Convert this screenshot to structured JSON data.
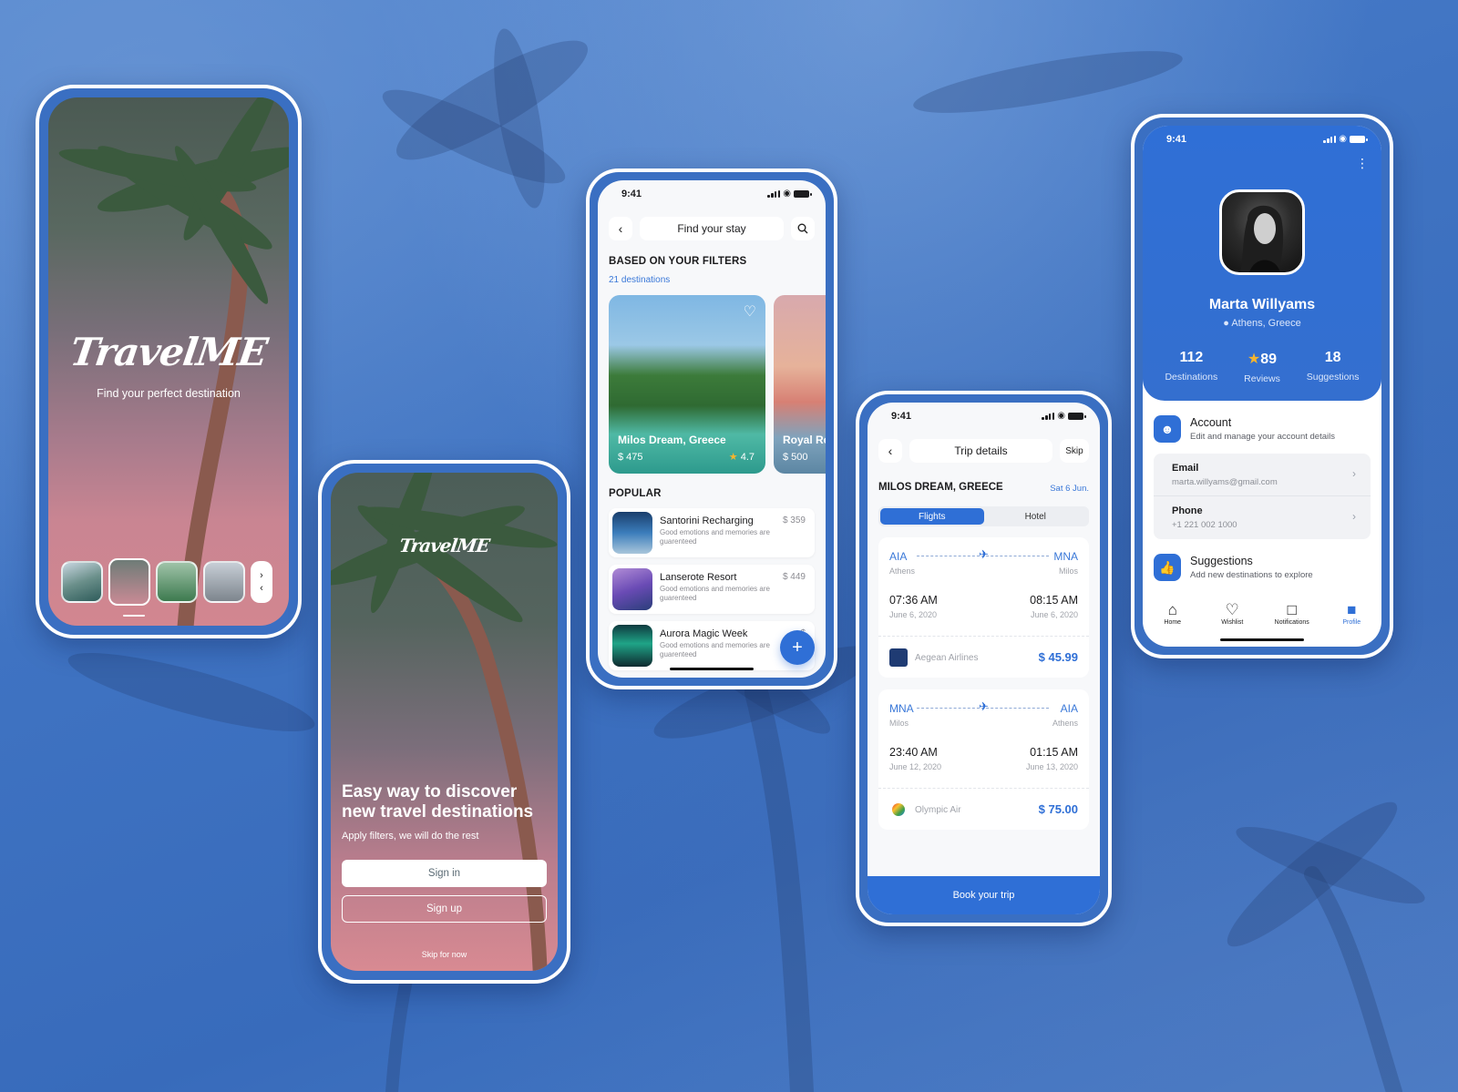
{
  "colors": {
    "accent": "#2f6fd6",
    "background": "#3f74c4",
    "star": "#f5b52e"
  },
  "splash": {
    "logo": "TravelME",
    "tagline": "Find your perfect destination",
    "thumb_next_icons": [
      "chevron-right-icon",
      "chevron-left-icon"
    ]
  },
  "onboarding": {
    "logo": "TravelME",
    "headline": "Easy way to discover new travel destinations",
    "subtitle": "Apply filters, we will do the rest",
    "sign_in": "Sign in",
    "sign_up": "Sign up",
    "skip": "Skip for now"
  },
  "stay": {
    "time": "9:41",
    "title": "Find your stay",
    "filters_heading": "BASED ON YOUR FILTERS",
    "destinations_count": "21 destinations",
    "featured": [
      {
        "name": "Milos Dream, Greece",
        "price": "$ 475",
        "rating": "4.7"
      },
      {
        "name": "Royal Res",
        "price": "$ 500"
      }
    ],
    "popular_heading": "POPULAR",
    "popular": [
      {
        "name": "Santorini Recharging",
        "desc": "Good emotions and memories are guarenteed",
        "price": "$ 359"
      },
      {
        "name": "Lanserote Resort",
        "desc": "Good emotions and memories are guarenteed",
        "price": "$ 449"
      },
      {
        "name": "Aurora Magic Week",
        "desc": "Good emotions and memories are guarenteed",
        "price": "$"
      }
    ],
    "fab": "+"
  },
  "trip": {
    "time": "9:41",
    "title": "Trip details",
    "skip": "Skip",
    "destination": "MILOS DREAM, GREECE",
    "date": "Sat 6 Jun.",
    "tabs": [
      "Flights",
      "Hotel"
    ],
    "flights": [
      {
        "from": "AIA",
        "from_city": "Athens",
        "to": "MNA",
        "to_city": "Milos",
        "depart_time": "07:36 AM",
        "depart_date": "June 6, 2020",
        "arrive_time": "08:15 AM",
        "arrive_date": "June 6, 2020",
        "airline": "Aegean Airlines",
        "price": "$ 45.99"
      },
      {
        "from": "MNA",
        "from_city": "Milos",
        "to": "AIA",
        "to_city": "Athens",
        "depart_time": "23:40 AM",
        "depart_date": "June 12, 2020",
        "arrive_time": "01:15 AM",
        "arrive_date": "June 13, 2020",
        "airline": "Olympic Air",
        "price": "$ 75.00"
      }
    ],
    "book": "Book your trip"
  },
  "profile": {
    "time": "9:41",
    "name": "Marta Willyams",
    "location": "Athens, Greece",
    "stats": [
      {
        "value": "112",
        "label": "Destinations"
      },
      {
        "value": "89",
        "label": "Reviews"
      },
      {
        "value": "18",
        "label": "Suggestions"
      }
    ],
    "account_title": "Account",
    "account_sub": "Edit and manage your account details",
    "email_label": "Email",
    "email_value": "marta.willyams@gmail.com",
    "phone_label": "Phone",
    "phone_value": "+1 221 002 1000",
    "suggest_title": "Suggestions",
    "suggest_sub": "Add new destinations to explore",
    "tabs": [
      "Home",
      "Wishlist",
      "Notifications",
      "Profile"
    ]
  }
}
